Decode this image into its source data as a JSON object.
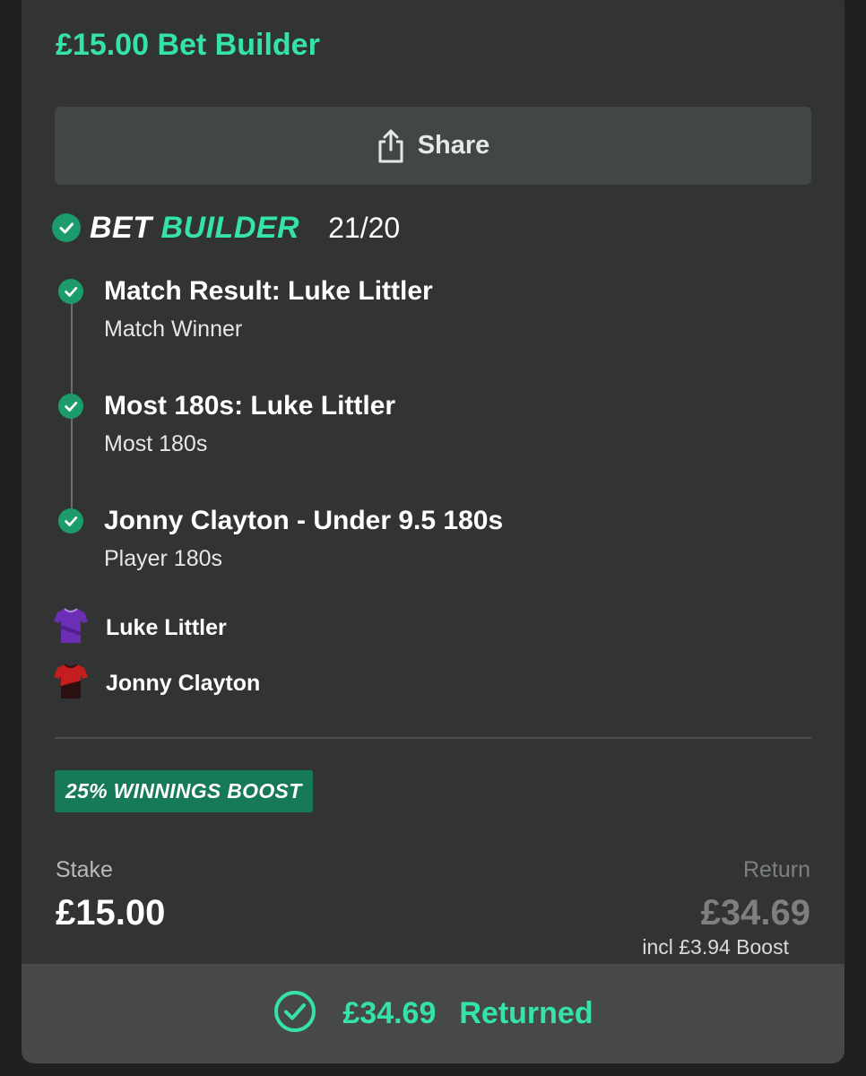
{
  "header": {
    "title": "£15.00 Bet Builder"
  },
  "share": {
    "label": "Share",
    "icon": "share-icon"
  },
  "bet_builder": {
    "word1": "BET",
    "word2": "BUILDER",
    "odds": "21/20"
  },
  "legs": [
    {
      "selection": "Match Result: Luke Littler",
      "market": "Match Winner"
    },
    {
      "selection": "Most 180s: Luke Littler",
      "market": "Most 180s"
    },
    {
      "selection": "Jonny Clayton - Under 9.5 180s",
      "market": "Player 180s"
    }
  ],
  "players": [
    {
      "name": "Luke Littler",
      "shirt_color": "#6a2fb5"
    },
    {
      "name": "Jonny Clayton",
      "shirt_color": "#c41e1e"
    }
  ],
  "boost": {
    "label": "25% WINNINGS BOOST"
  },
  "stake": {
    "label": "Stake",
    "value": "£15.00"
  },
  "return": {
    "label": "Return",
    "value": "£34.69",
    "note": "incl £3.94 Boost"
  },
  "status": {
    "amount": "£34.69",
    "label": "Returned"
  },
  "colors": {
    "accent": "#35e3a6",
    "success": "#1c9b6c",
    "card_bg": "#313432",
    "boost_bg": "#167a56"
  }
}
